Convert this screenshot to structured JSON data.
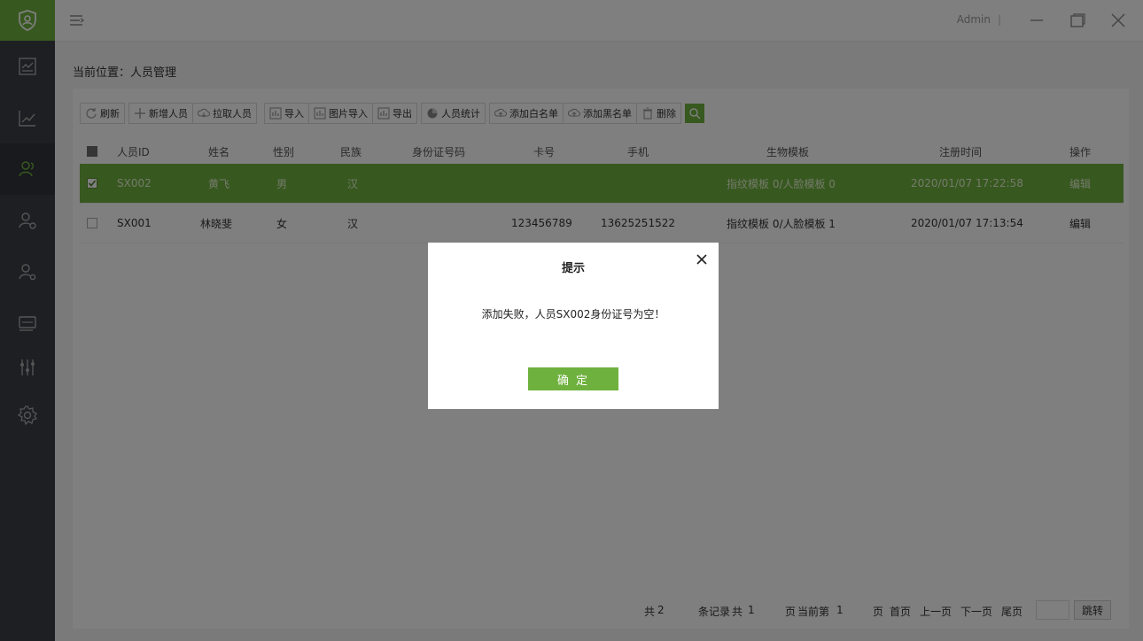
{
  "topbar": {
    "user": "Admin",
    "separator": "|"
  },
  "breadcrumb": {
    "label": "当前位置：",
    "page": "人员管理"
  },
  "toolbar": {
    "refresh": "刷新",
    "add_person": "新增人员",
    "pull_person": "拉取人员",
    "import": "导入",
    "image_import": "图片导入",
    "export": "导出",
    "person_stats": "人员统计",
    "add_whitelist": "添加白名单",
    "add_blacklist": "添加黑名单",
    "delete": "删除"
  },
  "table": {
    "headers": [
      "人员ID",
      "姓名",
      "性别",
      "民族",
      "身份证号码",
      "卡号",
      "手机",
      "生物模板",
      "注册时间",
      "操作"
    ],
    "rows": [
      {
        "selected": true,
        "person_id": "SX002",
        "name": "黄飞",
        "gender": "男",
        "ethnicity": "汉",
        "id_number": "",
        "card_no": "",
        "phone": "",
        "bio_template": "指纹模板 0/人脸模板 0",
        "reg_time": "2020/01/07 17:22:58",
        "action": "编辑"
      },
      {
        "selected": false,
        "person_id": "SX001",
        "name": "林晓斐",
        "gender": "女",
        "ethnicity": "汉",
        "id_number": "",
        "card_no": "123456789",
        "phone": "13625251522",
        "bio_template": "指纹模板 0/人脸模板 1",
        "reg_time": "2020/01/07 17:13:54",
        "action": "编辑"
      }
    ]
  },
  "pager": {
    "total_prefix": "共",
    "total_records": "2",
    "records_suffix": "条记录",
    "pages_prefix": "共",
    "total_pages": "1",
    "pages_suffix": "页",
    "current_prefix": "当前第",
    "current_page": "1",
    "current_suffix": "页",
    "first": "首页",
    "prev": "上一页",
    "next": "下一页",
    "last": "尾页",
    "jump": "跳转"
  },
  "dialog": {
    "title": "提示",
    "message": "添加失败，人员SX002身份证号为空！",
    "ok": "确 定"
  },
  "colors": {
    "accent": "#6fb13e",
    "sidebar": "#3b3f44"
  }
}
